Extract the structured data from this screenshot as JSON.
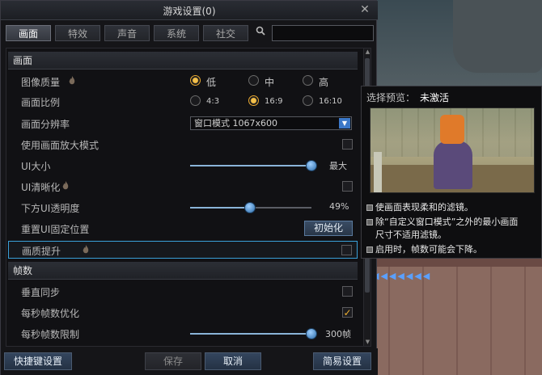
{
  "window": {
    "title": "游戏设置(0)"
  },
  "tabs": [
    {
      "label": "画面",
      "active": true
    },
    {
      "label": "特效",
      "active": false
    },
    {
      "label": "声音",
      "active": false
    },
    {
      "label": "系统",
      "active": false
    },
    {
      "label": "社交",
      "active": false
    }
  ],
  "search": {
    "icon": "search-icon",
    "value": ""
  },
  "sections": {
    "display": "画面",
    "framerate": "帧数"
  },
  "settings": {
    "quality": {
      "label": "图像质量",
      "options": [
        "低",
        "中",
        "高"
      ],
      "selected": "低"
    },
    "ratio": {
      "label": "画面比例",
      "options": [
        "4:3",
        "16:9",
        "16:10"
      ],
      "selected": "16:9"
    },
    "resolution": {
      "label": "画面分辨率",
      "value": "窗口模式 1067x600"
    },
    "zoom": {
      "label": "使用画面放大模式",
      "checked": false
    },
    "ui_size": {
      "label": "UI大小",
      "value_text": "最大",
      "level": 1.0
    },
    "ui_sharpen": {
      "label": "UI清晰化",
      "checked": false
    },
    "ui_opacity": {
      "label": "下方UI透明度",
      "value_text": "49%",
      "level": 0.49
    },
    "ui_reset": {
      "label": "重置UI固定位置",
      "button": "初始化"
    },
    "quality_boost": {
      "label": "画质提升",
      "checked": false
    },
    "vsync": {
      "label": "垂直同步",
      "checked": false
    },
    "fps_opt": {
      "label": "每秒帧数优化",
      "checked": true
    },
    "fps_limit": {
      "label": "每秒帧数限制",
      "value_text": "300帧",
      "level": 1.0
    }
  },
  "bottom": {
    "quick": "快捷键设置",
    "save": "保存",
    "cancel": "取消",
    "simple": "简易设置"
  },
  "preview": {
    "title": "选择预览：",
    "status": "未激活",
    "bullets": [
      "使画面表现柔和的滤镜。",
      "除“自定义窗口模式”之外的最小画面",
      "尺寸不适用滤镜。",
      "启用时，帧数可能会下降。"
    ]
  },
  "colors": {
    "accent": "#3aa0d8",
    "radio_on": "#f4c04a",
    "button_blue": "#34465e"
  }
}
